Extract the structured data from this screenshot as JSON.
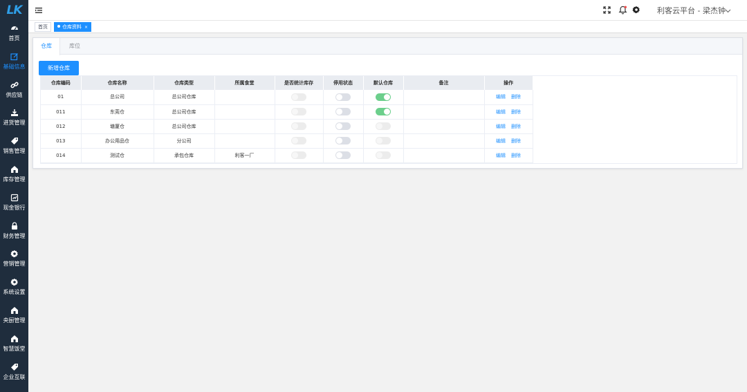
{
  "app": {
    "logo_text": "LK",
    "user": "利客云平台 - 梁杰钟"
  },
  "sidebar": {
    "items": [
      {
        "label": "首页",
        "icon": "dashboard-icon",
        "active": false
      },
      {
        "label": "基础信息",
        "icon": "edit-icon",
        "active": true
      },
      {
        "label": "供应链",
        "icon": "link-icon",
        "active": false
      },
      {
        "label": "进货管理",
        "icon": "download-icon",
        "active": false
      },
      {
        "label": "销售管理",
        "icon": "tag-icon",
        "active": false
      },
      {
        "label": "库存管理",
        "icon": "home-icon",
        "active": false
      },
      {
        "label": "现金银行",
        "icon": "chart-icon",
        "active": false
      },
      {
        "label": "财务管理",
        "icon": "lock-icon",
        "active": false
      },
      {
        "label": "营销管理",
        "icon": "gear-icon",
        "active": false
      },
      {
        "label": "系统设置",
        "icon": "gear-icon",
        "active": false
      },
      {
        "label": "央厨管理",
        "icon": "home-icon",
        "active": false
      },
      {
        "label": "智慧饭堂",
        "icon": "home-icon",
        "active": false
      },
      {
        "label": "企业互联",
        "icon": "tag-icon",
        "active": false
      }
    ]
  },
  "tags": {
    "home": "首页",
    "current": "仓库资料"
  },
  "tabs": {
    "warehouse": "仓库",
    "location": "库位"
  },
  "toolbar": {
    "add_label": "新增仓库"
  },
  "table": {
    "columns": [
      "仓库编码",
      "仓库名称",
      "仓库类型",
      "所属食堂",
      "是否统计库存",
      "停用状态",
      "默认仓库",
      "备注",
      "操作"
    ],
    "edit_label": "编辑",
    "delete_label": "删除",
    "rows": [
      {
        "code": "01",
        "name": "总公司",
        "type": "总公司仓库",
        "canteen": "",
        "count_stock": false,
        "disabled": false,
        "default": true,
        "remark": ""
      },
      {
        "code": "011",
        "name": "东莞仓",
        "type": "总公司仓库",
        "canteen": "",
        "count_stock": false,
        "disabled": false,
        "default": true,
        "remark": ""
      },
      {
        "code": "012",
        "name": "塘厦仓",
        "type": "总公司仓库",
        "canteen": "",
        "count_stock": false,
        "disabled": false,
        "default": false,
        "remark": ""
      },
      {
        "code": "013",
        "name": "办公用品仓",
        "type": "分公司",
        "canteen": "",
        "count_stock": false,
        "disabled": false,
        "default": false,
        "remark": ""
      },
      {
        "code": "014",
        "name": "测试仓",
        "type": "承包仓库",
        "canteen": "利客一厂",
        "count_stock": false,
        "disabled": false,
        "default": false,
        "remark": ""
      }
    ]
  },
  "colors": {
    "sidebar_bg": "#1f2d3d",
    "accent": "#1e90ff",
    "switch_on": "#6ccf8c"
  }
}
